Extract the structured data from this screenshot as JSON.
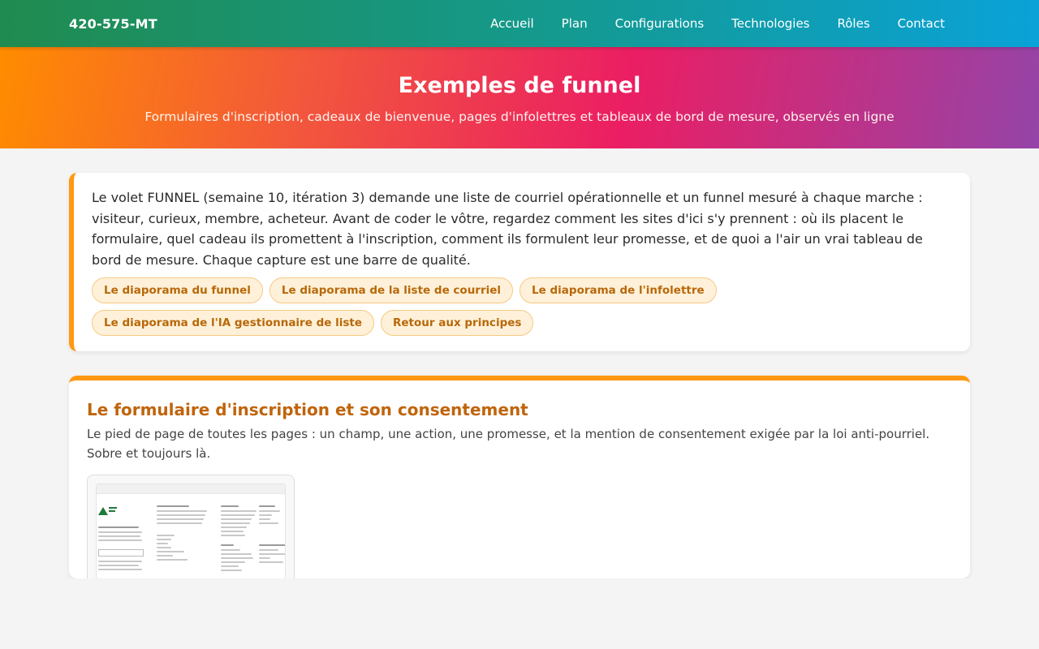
{
  "nav": {
    "brand": "420-575-MT",
    "links": [
      "Accueil",
      "Plan",
      "Configurations",
      "Technologies",
      "Rôles",
      "Contact"
    ]
  },
  "hero": {
    "title": "Exemples de funnel",
    "subtitle": "Formulaires d'inscription, cadeaux de bienvenue, pages d'infolettres et tableaux de bord de mesure, observés en ligne"
  },
  "intro": {
    "text": "Le volet FUNNEL (semaine 10, itération 3) demande une liste de courriel opérationnelle et un funnel mesuré à chaque marche : visiteur, curieux, membre, acheteur. Avant de coder le vôtre, regardez comment les sites d'ici s'y prennent : où ils placent le formulaire, quel cadeau ils promettent à l'inscription, comment ils formulent leur promesse, et de quoi a l'air un vrai tableau de bord de mesure. Chaque capture est une barre de qualité.",
    "links": [
      "Le diaporama du funnel",
      "Le diaporama de la liste de courriel",
      "Le diaporama de l'infolettre",
      "Le diaporama de l'IA gestionnaire de liste",
      "Retour aux principes"
    ]
  },
  "section": {
    "title": "Le formulaire d'inscription et son consentement",
    "description": "Le pied de page de toutes les pages : un champ, une action, une promesse, et la mention de consentement exigée par la loi anti-pourriel. Sobre et toujours là."
  },
  "colors": {
    "accent": "#ff9813",
    "heading": "#c0640b",
    "pill_text": "#b8680a"
  }
}
